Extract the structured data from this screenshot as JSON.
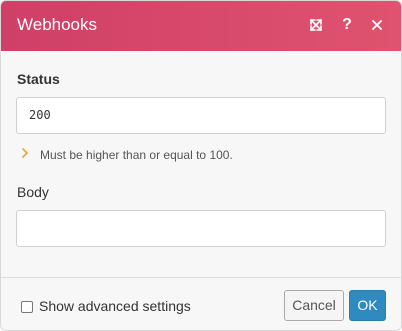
{
  "dialog": {
    "title": "Webhooks",
    "header_icons": [
      "expand-icon",
      "help-icon",
      "close-icon"
    ],
    "header_color": "#d9486c"
  },
  "form": {
    "status_label": "Status",
    "status_value": "200",
    "status_hint": "Must be higher than or equal to 100.",
    "body_label": "Body",
    "body_value": ""
  },
  "footer": {
    "advanced_checkbox_label": "Show advanced settings",
    "advanced_checked": false,
    "cancel_label": "Cancel",
    "ok_label": "OK",
    "ok_color": "#2f8bbf"
  }
}
